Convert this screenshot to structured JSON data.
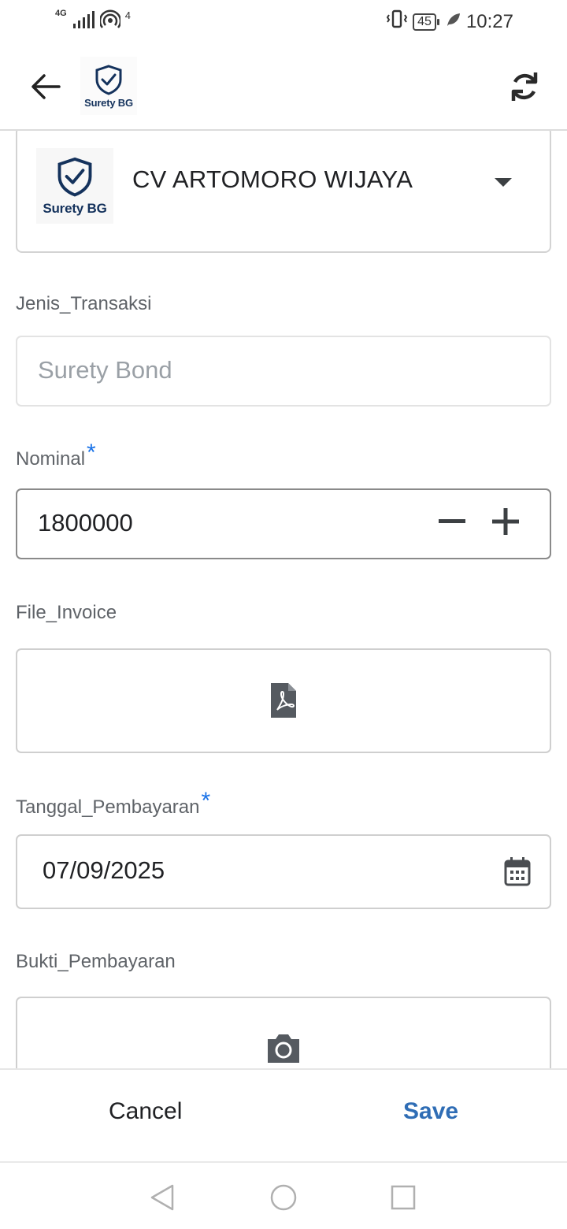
{
  "status_bar": {
    "network": "4G",
    "hotspot_count": "4",
    "battery": "45",
    "time": "10:27"
  },
  "app_bar": {
    "logo_text": "Surety BG"
  },
  "company": {
    "logo_text": "Surety BG",
    "name": "CV ARTOMORO WIJAYA"
  },
  "fields": {
    "jenis_transaksi": {
      "label": "Jenis_Transaksi",
      "value": "Surety Bond"
    },
    "nominal": {
      "label": "Nominal",
      "required_mark": "*",
      "value": "1800000"
    },
    "file_invoice": {
      "label": "File_Invoice"
    },
    "tanggal_pembayaran": {
      "label": "Tanggal_Pembayaran",
      "required_mark": "*",
      "value": "07/09/2025"
    },
    "bukti_pembayaran": {
      "label": "Bukti_Pembayaran"
    }
  },
  "actions": {
    "cancel": "Cancel",
    "save": "Save"
  },
  "colors": {
    "accent": "#2f6db5",
    "required": "#1a73e8",
    "logo": "#14325c"
  },
  "icons": [
    "back-arrow-icon",
    "sync-icon",
    "dropdown-caret-icon",
    "minus-icon",
    "plus-icon",
    "pdf-file-icon",
    "calendar-icon",
    "camera-icon",
    "nav-back-icon",
    "nav-home-icon",
    "nav-recents-icon"
  ]
}
